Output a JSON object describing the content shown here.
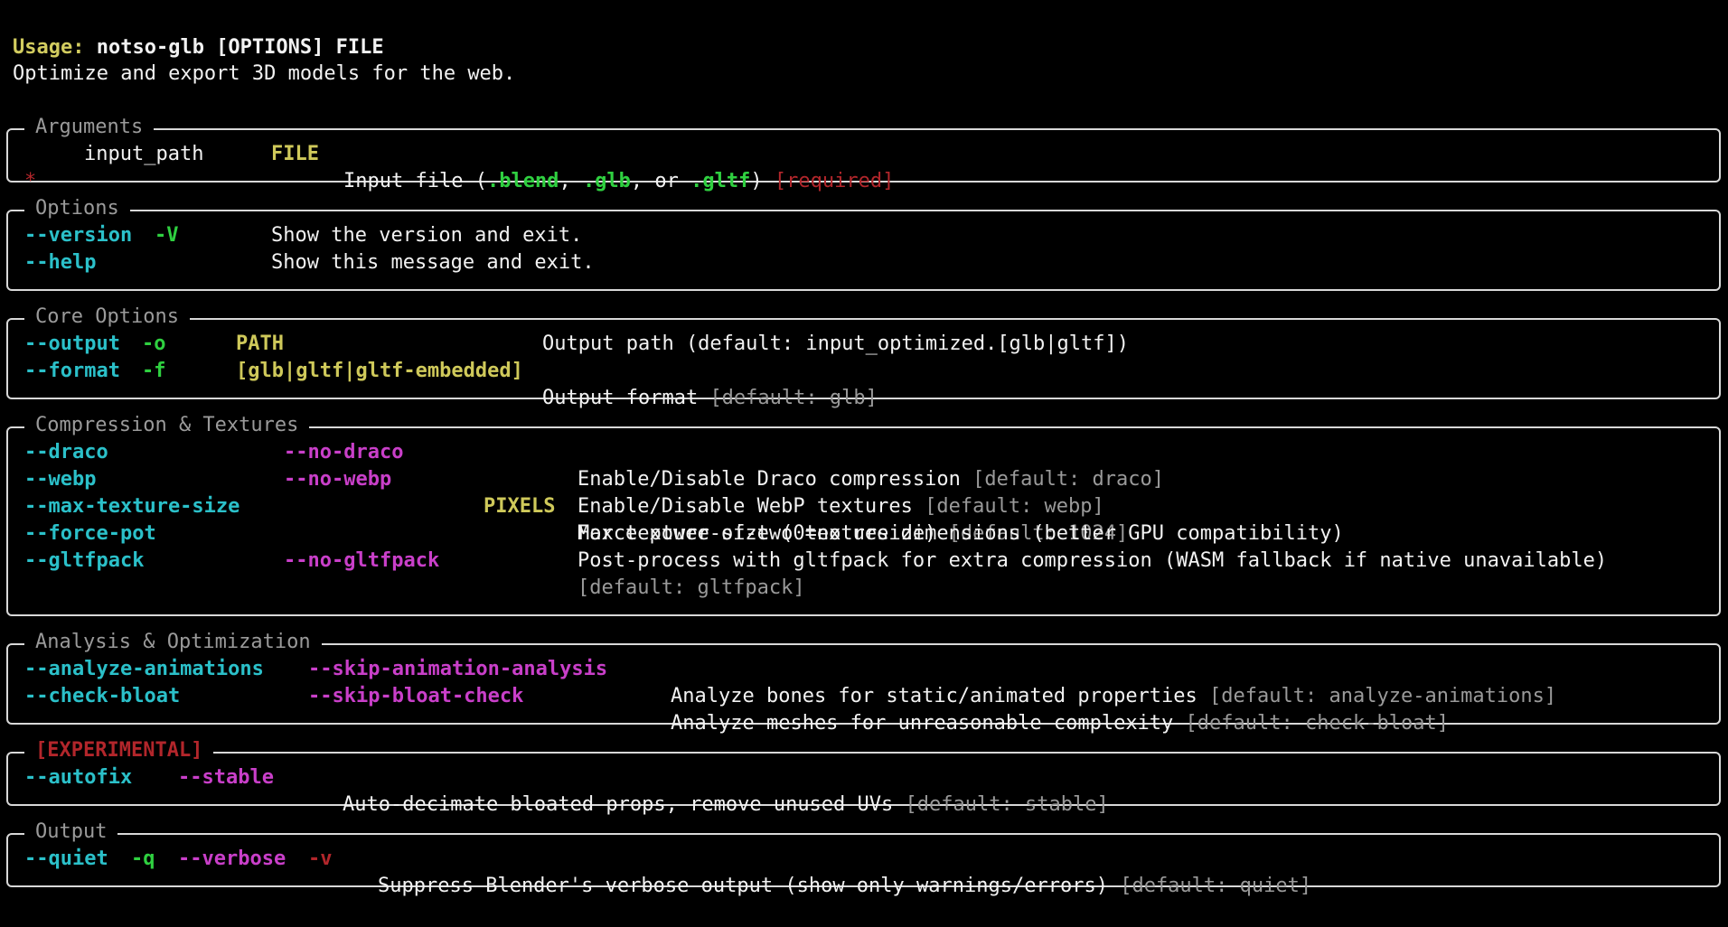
{
  "usage": {
    "label": "Usage:",
    "text": " notso-glb [OPTIONS] FILE"
  },
  "description": "Optimize and export 3D models for the web.",
  "panels": {
    "arguments": {
      "title": "Arguments",
      "rows": [
        {
          "star": "*",
          "name": "input_path",
          "metavar": "FILE",
          "help_parts": [
            "Input file (",
            ".blend",
            ", ",
            ".glb",
            ", or ",
            ".gltf",
            ") "
          ],
          "required": "[required]"
        }
      ]
    },
    "options": {
      "title": "Options",
      "rows": [
        {
          "flag": "--version",
          "short": "-V",
          "help": "Show the version and exit."
        },
        {
          "flag": "--help",
          "short": "",
          "help": "Show this message and exit."
        }
      ]
    },
    "core": {
      "title": "Core Options",
      "rows": [
        {
          "flag": "--output",
          "short": "-o",
          "metavar": "PATH",
          "help": "Output path (default: input_optimized.[glb|gltf])",
          "default": ""
        },
        {
          "flag": "--format",
          "short": "-f",
          "metavar": "[glb|gltf|gltf-embedded]",
          "help": "Output format ",
          "default": "[default: glb]"
        }
      ]
    },
    "compression": {
      "title": "Compression & Textures",
      "rows": [
        {
          "flag": "--draco",
          "neg": "--no-draco",
          "metavar": "",
          "help": "Enable/Disable Draco compression ",
          "default": "[default: draco]"
        },
        {
          "flag": "--webp",
          "neg": "--no-webp",
          "metavar": "",
          "help": "Enable/Disable WebP textures ",
          "default": "[default: webp]"
        },
        {
          "flag": "--max-texture-size",
          "neg": "",
          "metavar": "PIXELS",
          "help": "Max texture size (0=no resize) ",
          "default": "[default: 1024]"
        },
        {
          "flag": "--force-pot",
          "neg": "",
          "metavar": "",
          "help": "Force power-of-two texture dimensions (better GPU compatibility)",
          "default": ""
        },
        {
          "flag": "--gltfpack",
          "neg": "--no-gltfpack",
          "metavar": "",
          "help": "Post-process with gltfpack for extra compression (WASM fallback if native unavailable)",
          "default": "[default: gltfpack]"
        }
      ]
    },
    "analysis": {
      "title": "Analysis & Optimization",
      "rows": [
        {
          "flag": "--analyze-animations",
          "neg": "--skip-animation-analysis",
          "help": "Analyze bones for static/animated properties ",
          "default": "[default: analyze-animations]"
        },
        {
          "flag": "--check-bloat",
          "neg": "--skip-bloat-check",
          "help": "Analyze meshes for unreasonable complexity ",
          "default": "[default: check-bloat]"
        }
      ]
    },
    "experimental": {
      "title": "[EXPERIMENTAL]",
      "rows": [
        {
          "flag": "--autofix",
          "neg": "--stable",
          "help": "Auto-decimate bloated props, remove unused UVs ",
          "default": "[default: stable]"
        }
      ]
    },
    "output": {
      "title": "Output",
      "rows": [
        {
          "flag": "--quiet",
          "short": "-q",
          "neg": "--verbose",
          "neg_short": "-v",
          "help": "Suppress Blender's verbose output (show only warnings/errors) ",
          "default": "[default: quiet]"
        }
      ]
    }
  },
  "colors": {
    "background": "#000000",
    "flag": "#2bc0c9",
    "short_flag": "#2fd040",
    "negation": "#c93fc9",
    "metavar": "#cfc95a",
    "required": "#b2262b",
    "default": "#9a9a9a",
    "border": "#d8d8d8"
  }
}
